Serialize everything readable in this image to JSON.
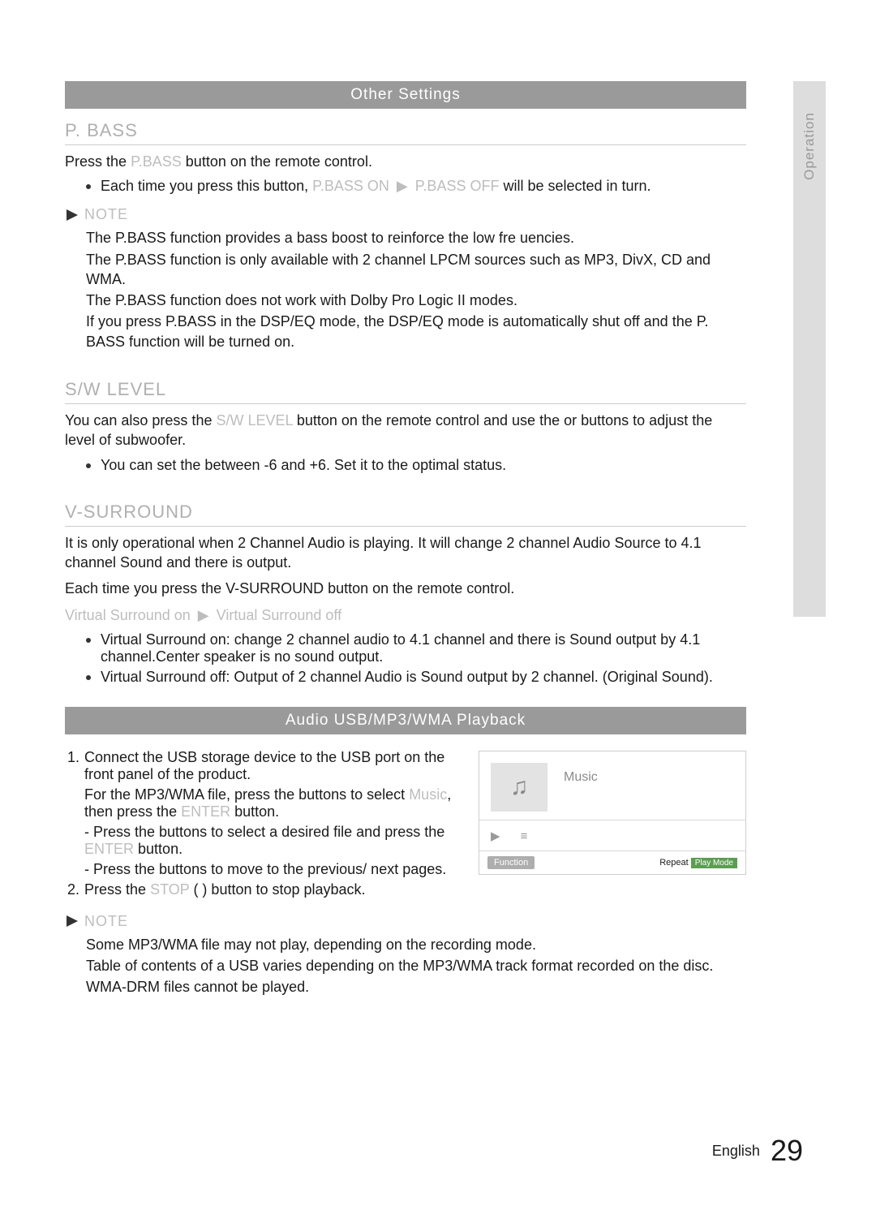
{
  "sideTab": "Operation",
  "section1": {
    "header": "Other Settings",
    "sub1": {
      "title": "P. BASS",
      "lead": "Press the",
      "lead_light": "P.BASS",
      "lead2": "button on the remote control.",
      "bullet1_a": "Each time you press this button,",
      "bullet1_b": "P.BASS ON",
      "bullet1_arrow": "▶",
      "bullet1_c": "P.BASS OFF",
      "bullet1_d": "will be selected in turn.",
      "note_label": "NOTE",
      "note1": "The P.BASS function provides a bass boost to reinforce the low fre uencies.",
      "note2": "The P.BASS function is only available with 2 channel LPCM sources such as MP3, DivX, CD and WMA.",
      "note3": "The P.BASS function does not work with Dolby Pro Logic II modes.",
      "note4": "If you press P.BASS in the DSP/EQ mode, the DSP/EQ mode is automatically shut off and the P. BASS function will be turned on."
    },
    "sub2": {
      "title": "S/W LEVEL",
      "p1_a": "You can also press the",
      "p1_light": "S/W LEVEL",
      "p1_b": "button on the remote control and use the   or             buttons to adjust the level of subwoofer.",
      "bullet1": "You can set the between -6 and +6. Set it to the optimal status."
    },
    "sub3": {
      "title": "V-SURROUND",
      "p1": "It is only operational when 2 Channel Audio is playing. It will change 2 channel Audio Source to 4.1 channel Sound and there is output.",
      "p2": "Each time you press the V-SURROUND button on the remote control.",
      "toggle_a": "Virtual Surround on",
      "toggle_arrow": "▶",
      "toggle_b": "Virtual Surround off",
      "bullet1": "Virtual Surround on:  change 2 channel audio to 4.1 channel and there is Sound output by 4.1 channel.Center speaker is no sound output.",
      "bullet2": "Virtual Surround off: Output of 2 channel Audio is Sound output by 2 channel. (Original Sound)."
    }
  },
  "section2": {
    "header": "Audio USB/MP3/WMA Playback",
    "step1_a": "Connect the USB storage device to the USB port on the front panel of the product.",
    "step1_b1": "For the MP3/WMA file, press the  buttons to select",
    "step1_b_light": "Music",
    "step1_b2": ", then press the",
    "step1_b_light2": "ENTER",
    "step1_b3": "button.",
    "step1_c": "- Press the  buttons to select  a desired file and press the",
    "step1_c_light": "ENTER",
    "step1_c2": "button.",
    "step1_d": "- Press the  buttons to move to the previous/ next pages.",
    "step2_a": "Press the",
    "step2_light": "STOP",
    "step2_b": "(      ) button to stop playback.",
    "note_label": "NOTE",
    "note1": "Some MP3/WMA file may not play, depending on the recording mode.",
    "note2": "Table of contents of a USB varies depending on the MP3/WMA track format recorded on the disc.",
    "note3": "WMA-DRM files cannot be played."
  },
  "media": {
    "title": "Music",
    "play_icon": "▶",
    "list_icon": "≡",
    "func_label": "Function",
    "repeat_label": "Repeat",
    "repeat_mark": "Play Mode"
  },
  "footer": {
    "lang": "English",
    "page": "29"
  }
}
